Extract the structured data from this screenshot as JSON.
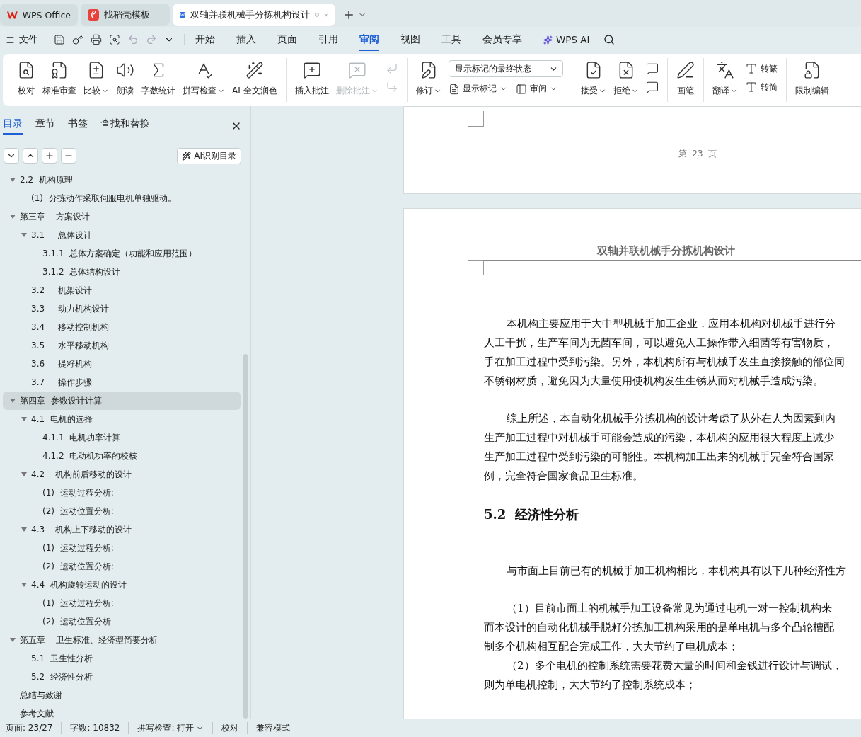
{
  "tabs": [
    {
      "label": "WPS Office",
      "selected": false
    },
    {
      "label": "找稻壳模板",
      "selected": false
    },
    {
      "label": "双轴并联机械手分拣机构设计",
      "selected": true
    }
  ],
  "menu": {
    "file": "文件",
    "tabs": [
      {
        "label": "开始",
        "selected": false
      },
      {
        "label": "插入",
        "selected": false
      },
      {
        "label": "页面",
        "selected": false
      },
      {
        "label": "引用",
        "selected": false
      },
      {
        "label": "审阅",
        "selected": true
      },
      {
        "label": "视图",
        "selected": false
      },
      {
        "label": "工具",
        "selected": false
      },
      {
        "label": "会员专享",
        "selected": false
      },
      {
        "label": "WPS AI",
        "selected": false
      }
    ]
  },
  "ribbon": {
    "groups": [
      {
        "columns": [
          {
            "kind": "large",
            "label": "校对"
          },
          {
            "kind": "large",
            "label": "标准审查"
          },
          {
            "kind": "large",
            "label": "比较",
            "dropdown": true
          },
          {
            "kind": "large",
            "label": "朗读"
          },
          {
            "kind": "large",
            "label": "字数统计"
          },
          {
            "kind": "large",
            "label": "拼写检查",
            "dropdown": true
          },
          {
            "kind": "large",
            "label": "AI 全文润色"
          }
        ]
      },
      {
        "columns": [
          {
            "kind": "large",
            "label": "插入批注"
          },
          {
            "kind": "large",
            "label": "删除批注",
            "dropdown": true,
            "disabled": true
          },
          {
            "kind": "stack",
            "items": [
              {
                "disabled": true
              },
              {
                "disabled": true
              }
            ]
          }
        ]
      },
      {
        "columns": [
          {
            "kind": "large",
            "label": "修订",
            "dropdown": true
          },
          {
            "kind": "select",
            "value": "显示标记的最终状态",
            "buttons": [
              {
                "label": "显示标记",
                "dropdown": true
              },
              {
                "label": "审阅",
                "dropdown": true
              }
            ]
          }
        ]
      },
      {
        "columns": [
          {
            "kind": "large",
            "label": "接受",
            "dropdown": true
          },
          {
            "kind": "large",
            "label": "拒绝",
            "dropdown": true
          },
          {
            "kind": "stack",
            "items": [
              {
                "disabled": false
              },
              {
                "disabled": false
              }
            ]
          }
        ]
      },
      {
        "columns": [
          {
            "kind": "large",
            "label": "画笔"
          }
        ]
      },
      {
        "columns": [
          {
            "kind": "large",
            "label": "翻译",
            "dropdown": true
          },
          {
            "kind": "stack",
            "items": [
              {
                "label": "转繁",
                "disabled": false
              },
              {
                "label": "转简",
                "disabled": false
              }
            ]
          }
        ]
      },
      {
        "columns": [
          {
            "kind": "large",
            "label": "限制编辑"
          }
        ]
      }
    ]
  },
  "pane": {
    "tabs": [
      {
        "label": "目录",
        "selected": true
      },
      {
        "label": "章节",
        "selected": false
      },
      {
        "label": "书签",
        "selected": false
      },
      {
        "label": "查找和替换",
        "selected": false
      }
    ],
    "ai_button": "AI识别目录"
  },
  "toc": {
    "items": [
      {
        "label": "2.2  机构原理",
        "selected": false,
        "expanded": true,
        "children": [
          {
            "label": "(1)  分拣动作采取伺服电机单独驱动。",
            "selected": false
          }
        ]
      },
      {
        "label": "第三章    方案设计",
        "selected": false,
        "expanded": true,
        "children": [
          {
            "label": "3.1     总体设计",
            "selected": false,
            "expanded": true,
            "children": [
              {
                "label": "3.1.1  总体方案确定（功能和应用范围）",
                "selected": false
              },
              {
                "label": "3.1.2  总体结构设计",
                "selected": false
              }
            ]
          },
          {
            "label": "3.2     机架设计",
            "selected": false
          },
          {
            "label": "3.3     动力机构设计",
            "selected": false
          },
          {
            "label": "3.4     移动控制机构",
            "selected": false
          },
          {
            "label": "3.5     水平移动机构",
            "selected": false
          },
          {
            "label": "3.6     提籽机构",
            "selected": false
          },
          {
            "label": "3.7     操作步骤",
            "selected": false
          }
        ]
      },
      {
        "label": "第四章  参数设计计算",
        "selected": true,
        "expanded": true,
        "children": [
          {
            "label": "4.1  电机的选择",
            "selected": false,
            "expanded": true,
            "children": [
              {
                "label": "4.1.1  电机功率计算",
                "selected": false
              },
              {
                "label": "4.1.2  电动机功率的校核",
                "selected": false
              }
            ]
          },
          {
            "label": "4.2    机构前后移动的设计",
            "selected": false,
            "expanded": true,
            "children": [
              {
                "label": "(1)  运动过程分析:",
                "selected": false
              },
              {
                "label": "(2)  运动位置分析:",
                "selected": false
              }
            ]
          },
          {
            "label": "4.3    机构上下移动的设计",
            "selected": false,
            "expanded": true,
            "children": [
              {
                "label": "(1)  运动过程分析:",
                "selected": false
              },
              {
                "label": "(2)  运动位置分析:",
                "selected": false
              }
            ]
          },
          {
            "label": "4.4  机构旋转运动的设计",
            "selected": false,
            "expanded": true,
            "children": [
              {
                "label": "(1)  运动过程分析:",
                "selected": false
              },
              {
                "label": "(2)  运动位置分析",
                "selected": false
              }
            ]
          }
        ]
      },
      {
        "label": "第五章    卫生标准、经济型简要分析",
        "selected": false,
        "expanded": true,
        "children": [
          {
            "label": "5.1  卫生性分析",
            "selected": false
          },
          {
            "label": "5.2  经济性分析",
            "selected": false
          }
        ]
      },
      {
        "label": "总结与致谢",
        "selected": false
      },
      {
        "label": "参考文献",
        "selected": false
      }
    ]
  },
  "document": {
    "prev_page": {
      "footer": "第  23  页"
    },
    "page": {
      "header": "双轴并联机械手分拣机构设计",
      "blocks": [
        {
          "kind": "paragraph",
          "lines": [
            "本机构主要应用于大中型机械手加工企业，应用本机构对机械手进行分",
            "人工干扰，生产车间为无菌车间，可以避免人工操作带入细菌等有害物质，",
            "手在加工过程中受到污染。另外，本机构所有与机械手发生直接接触的部位同",
            "不锈钢材质，避免因为大量使用使机构发生生锈从而对机械手造成污染。"
          ]
        },
        {
          "kind": "paragraph",
          "lines": [
            "综上所述，本自动化机械手分拣机构的设计考虑了从外在人为因素到内",
            "生产加工过程中对机械手可能会造成的污染，本机构的应用很大程度上减少",
            "生产加工过程中受到污染的可能性。本机构加工出来的机械手完全符合国家",
            "例，完全符合国家食品卫生标准。"
          ]
        },
        {
          "kind": "heading",
          "text": "5.2  经济性分析"
        },
        {
          "kind": "paragraph",
          "lines": [
            "与市面上目前已有的机械手加工机构相比，本机构具有以下几种经济性方"
          ]
        },
        {
          "kind": "list",
          "items": [
            {
              "lines": [
                "（1）目前市面上的机械手加工设备常见为通过电机一对一控制机构来",
                "而本设计的自动化机械手脱籽分拣加工机构采用的是单电机与多个凸轮槽配",
                "制多个机构相互配合完成工作，大大节约了电机成本；"
              ]
            },
            {
              "lines": [
                "（2）多个电机的控制系统需要花费大量的时间和金钱进行设计与调试，",
                "则为单电机控制，大大节约了控制系统成本；"
              ]
            }
          ]
        }
      ]
    }
  },
  "status_bar": [
    {
      "text": "页面: 23/27"
    },
    {
      "text": "字数: 10832"
    },
    {
      "text": "拼写检查: 打开",
      "dropdown": true
    },
    {
      "text": "校对"
    },
    {
      "text": "兼容模式"
    }
  ]
}
